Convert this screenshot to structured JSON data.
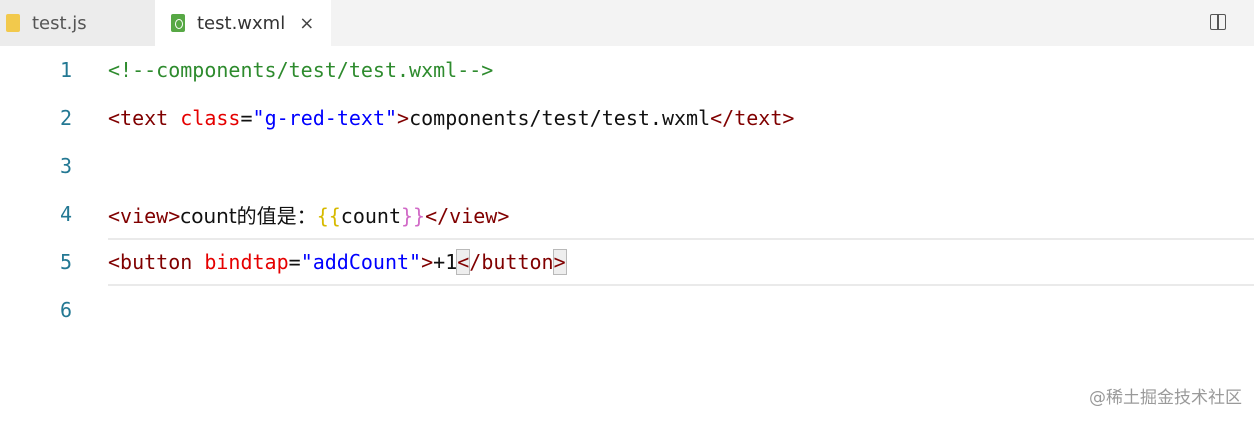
{
  "tabs": [
    {
      "label": "test.js",
      "icon": "js-file-icon",
      "active": false
    },
    {
      "label": "test.wxml",
      "icon": "wxml-file-icon",
      "active": true,
      "close": "×"
    }
  ],
  "editor": {
    "line_numbers": [
      "1",
      "2",
      "3",
      "4",
      "5",
      "6"
    ],
    "line1": {
      "comment": "<!--components/test/test.wxml-->"
    },
    "line2": {
      "open_tag": "<text",
      "attr": "class",
      "eq": "=",
      "value": "\"g-red-text\"",
      "gt": ">",
      "text": "components/test/test.wxml",
      "close_tag": "</text>"
    },
    "line4": {
      "open_tag": "<view>",
      "text": "count的值是：",
      "brace_open": "{{",
      "var": "count",
      "brace_close": "}}",
      "close_tag": "</view>"
    },
    "line5": {
      "open_tag": "<button",
      "attr": "bindtap",
      "eq": "=",
      "value": "\"addCount\"",
      "gt": ">",
      "text": "+1",
      "close_tag_lt": "<",
      "close_tag_mid": "/button",
      "close_tag_gt": ">"
    }
  },
  "watermark": "@稀土掘金技术社区",
  "colors": {
    "comment": "#2e8b2e",
    "tag": "#800000",
    "attribute": "#e50000",
    "string": "#0000ff",
    "line_number": "#237893"
  }
}
